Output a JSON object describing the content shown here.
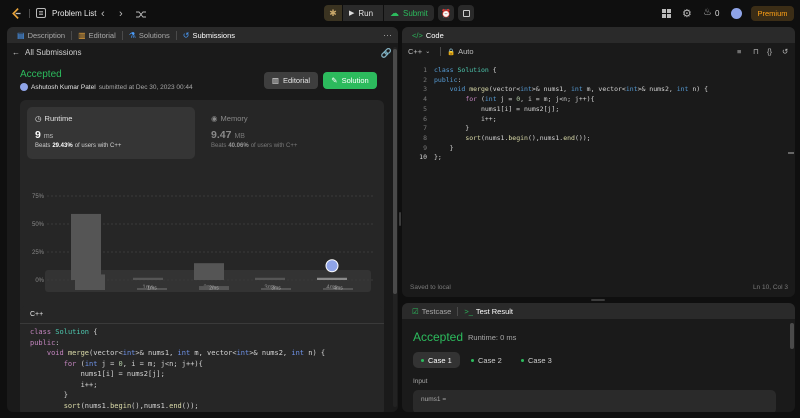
{
  "topbar": {
    "problem_list": "Problem List",
    "run": "Run",
    "submit": "Submit",
    "streak": "0",
    "premium": "Premium"
  },
  "left_tabs": {
    "description": "Description",
    "editorial": "Editorial",
    "solutions": "Solutions",
    "submissions": "Submissions"
  },
  "submission": {
    "back_label": "All Submissions",
    "status": "Accepted",
    "user": "Ashutosh Kumar Patel",
    "submitted_text": "submitted at Dec 30, 2023 00:44",
    "editorial_button": "Editorial",
    "solution_button": "Solution",
    "runtime": {
      "label": "Runtime",
      "value": "9",
      "unit": "ms",
      "beats_prefix": "Beats",
      "beats_pct": "29.43%",
      "beats_suffix": "of users with C++"
    },
    "memory": {
      "label": "Memory",
      "value": "9.47",
      "unit": "MB",
      "beats_prefix": "Beats",
      "beats_pct": "40.06%",
      "beats_suffix": "of users with C++"
    },
    "code_lang": "C++"
  },
  "chart_data": {
    "type": "bar",
    "categories": [
      "0ms",
      "1ms",
      "2ms",
      "3ms",
      "4ms"
    ],
    "x_tick_labels": [
      "",
      "1ms",
      "2ms",
      "3ms",
      "4ms"
    ],
    "values": [
      59,
      2,
      15,
      2,
      2
    ],
    "y_ticks": [
      "75%",
      "50%",
      "25%",
      "0%"
    ],
    "ylim": [
      0,
      75
    ],
    "mini_tick_labels": [
      "",
      "1ms",
      "2ms",
      "3ms",
      "4ms"
    ]
  },
  "code_panel": {
    "title": "Code",
    "language": "C++",
    "mode": "Auto",
    "saved": "Saved to local",
    "position": "Ln 10, Col 3",
    "line_numbers": [
      "1",
      "2",
      "3",
      "4",
      "5",
      "6",
      "7",
      "8",
      "9",
      "10"
    ]
  },
  "test_panel": {
    "tab_testcase": "Testcase",
    "tab_result": "Test Result",
    "status": "Accepted",
    "runtime": "Runtime: 0 ms",
    "cases": [
      "Case 1",
      "Case 2",
      "Case 3"
    ],
    "input_label": "Input",
    "var_label": "nums1 ="
  },
  "colors": {
    "accent_green": "#2cbb5d",
    "accent_orange": "#ffa116",
    "bg": "#0f0f0f",
    "panel": "#1a1a1a"
  }
}
